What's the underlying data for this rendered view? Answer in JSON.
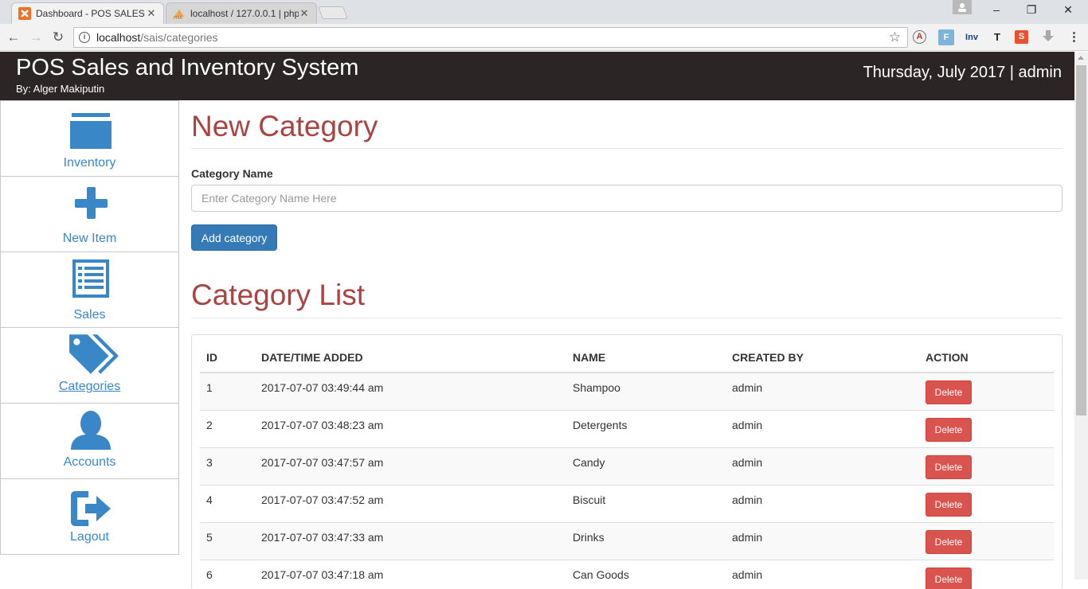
{
  "browser": {
    "tabs": [
      {
        "title": "Dashboard - POS SALES A",
        "active": true
      },
      {
        "title": "localhost / 127.0.0.1 | php",
        "active": false
      }
    ],
    "url_host": "localhost",
    "url_path": "/sais/categories",
    "extensions": [
      "A",
      "F",
      "Inv",
      "T",
      "S",
      "D"
    ],
    "window_controls": {
      "minimize": "–",
      "restore": "❐",
      "close": "✕"
    }
  },
  "header": {
    "title": "POS Sales and Inventory System",
    "subtitle": "By: Alger Makiputin",
    "right_text": "Thursday, July 2017 | admin"
  },
  "sidebar": {
    "items": [
      {
        "label": "Inventory",
        "icon": "folder-icon",
        "active": false
      },
      {
        "label": "New Item",
        "icon": "plus-icon",
        "active": false
      },
      {
        "label": "Sales",
        "icon": "list-icon",
        "active": false
      },
      {
        "label": "Categories",
        "icon": "tags-icon",
        "active": true
      },
      {
        "label": "Accounts",
        "icon": "user-icon",
        "active": false
      },
      {
        "label": "Lagout",
        "icon": "logout-icon",
        "active": false
      }
    ]
  },
  "form": {
    "heading": "New Category",
    "label": "Category Name",
    "placeholder": "Enter Category Name Here",
    "value": "",
    "submit_label": "Add category"
  },
  "list": {
    "heading": "Category List",
    "columns": [
      "ID",
      "DATE/TIME ADDED",
      "NAME",
      "CREATED BY",
      "ACTION"
    ],
    "delete_label": "Delete",
    "rows": [
      {
        "id": "1",
        "datetime": "2017-07-07 03:49:44 am",
        "name": "Shampoo",
        "created_by": "admin"
      },
      {
        "id": "2",
        "datetime": "2017-07-07 03:48:23 am",
        "name": "Detergents",
        "created_by": "admin"
      },
      {
        "id": "3",
        "datetime": "2017-07-07 03:47:57 am",
        "name": "Candy",
        "created_by": "admin"
      },
      {
        "id": "4",
        "datetime": "2017-07-07 03:47:52 am",
        "name": "Biscuit",
        "created_by": "admin"
      },
      {
        "id": "5",
        "datetime": "2017-07-07 03:47:33 am",
        "name": "Drinks",
        "created_by": "admin"
      },
      {
        "id": "6",
        "datetime": "2017-07-07 03:47:18 am",
        "name": "Can Goods",
        "created_by": "admin"
      }
    ]
  },
  "colors": {
    "header_bg": "#2b2525",
    "accent": "#3a87c8",
    "heading": "#a94442",
    "primary_button": "#337ab7",
    "danger_button": "#d9534f"
  }
}
